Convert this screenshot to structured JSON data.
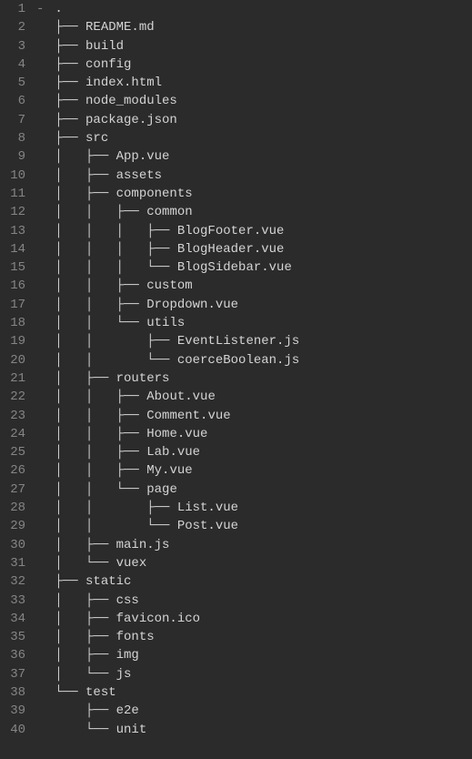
{
  "lines": [
    {
      "num": 1,
      "prefix": "",
      "name": "."
    },
    {
      "num": 2,
      "prefix": "├── ",
      "name": "README.md"
    },
    {
      "num": 3,
      "prefix": "├── ",
      "name": "build"
    },
    {
      "num": 4,
      "prefix": "├── ",
      "name": "config"
    },
    {
      "num": 5,
      "prefix": "├── ",
      "name": "index.html"
    },
    {
      "num": 6,
      "prefix": "├── ",
      "name": "node_modules"
    },
    {
      "num": 7,
      "prefix": "├── ",
      "name": "package.json"
    },
    {
      "num": 8,
      "prefix": "├── ",
      "name": "src"
    },
    {
      "num": 9,
      "prefix": "│   ├── ",
      "name": "App.vue"
    },
    {
      "num": 10,
      "prefix": "│   ├── ",
      "name": "assets"
    },
    {
      "num": 11,
      "prefix": "│   ├── ",
      "name": "components"
    },
    {
      "num": 12,
      "prefix": "│   │   ├── ",
      "name": "common"
    },
    {
      "num": 13,
      "prefix": "│   │   │   ├── ",
      "name": "BlogFooter.vue"
    },
    {
      "num": 14,
      "prefix": "│   │   │   ├── ",
      "name": "BlogHeader.vue"
    },
    {
      "num": 15,
      "prefix": "│   │   │   └── ",
      "name": "BlogSidebar.vue"
    },
    {
      "num": 16,
      "prefix": "│   │   ├── ",
      "name": "custom"
    },
    {
      "num": 17,
      "prefix": "│   │   ├── ",
      "name": "Dropdown.vue"
    },
    {
      "num": 18,
      "prefix": "│   │   └── ",
      "name": "utils"
    },
    {
      "num": 19,
      "prefix": "│   │       ├── ",
      "name": "EventListener.js"
    },
    {
      "num": 20,
      "prefix": "│   │       └── ",
      "name": "coerceBoolean.js"
    },
    {
      "num": 21,
      "prefix": "│   ├── ",
      "name": "routers"
    },
    {
      "num": 22,
      "prefix": "│   │   ├── ",
      "name": "About.vue"
    },
    {
      "num": 23,
      "prefix": "│   │   ├── ",
      "name": "Comment.vue"
    },
    {
      "num": 24,
      "prefix": "│   │   ├── ",
      "name": "Home.vue"
    },
    {
      "num": 25,
      "prefix": "│   │   ├── ",
      "name": "Lab.vue"
    },
    {
      "num": 26,
      "prefix": "│   │   ├── ",
      "name": "My.vue"
    },
    {
      "num": 27,
      "prefix": "│   │   └── ",
      "name": "page"
    },
    {
      "num": 28,
      "prefix": "│   │       ├── ",
      "name": "List.vue"
    },
    {
      "num": 29,
      "prefix": "│   │       └── ",
      "name": "Post.vue"
    },
    {
      "num": 30,
      "prefix": "│   ├── ",
      "name": "main.js"
    },
    {
      "num": 31,
      "prefix": "│   └── ",
      "name": "vuex"
    },
    {
      "num": 32,
      "prefix": "├── ",
      "name": "static"
    },
    {
      "num": 33,
      "prefix": "│   ├── ",
      "name": "css"
    },
    {
      "num": 34,
      "prefix": "│   ├── ",
      "name": "favicon.ico"
    },
    {
      "num": 35,
      "prefix": "│   ├── ",
      "name": "fonts"
    },
    {
      "num": 36,
      "prefix": "│   ├── ",
      "name": "img"
    },
    {
      "num": 37,
      "prefix": "│   └── ",
      "name": "js"
    },
    {
      "num": 38,
      "prefix": "└── ",
      "name": "test"
    },
    {
      "num": 39,
      "prefix": "    ├── ",
      "name": "e2e"
    },
    {
      "num": 40,
      "prefix": "    └── ",
      "name": "unit"
    }
  ],
  "fold_marker": "-"
}
